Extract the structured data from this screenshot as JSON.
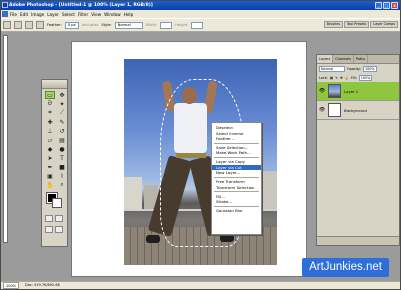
{
  "window": {
    "title": "Adobe Photoshop - [Untitled-1 @ 100% (Layer 1, RGB/8)]",
    "buttons": [
      "_",
      "□",
      "x"
    ]
  },
  "menubar": [
    "File",
    "Edit",
    "Image",
    "Layer",
    "Select",
    "Filter",
    "View",
    "Window",
    "Help"
  ],
  "options": {
    "feather_label": "Feather:",
    "feather_value": "0 px",
    "antialias_label": "Anti-alias",
    "style_label": "Style:",
    "style_value": "Normal",
    "width_label": "Width:",
    "height_label": "Height:"
  },
  "palette_well": [
    "Brushes",
    "Tool Presets",
    "Layer Comps"
  ],
  "context_menu": {
    "items": [
      "Deselect",
      "Select Inverse",
      "Feather...",
      "---",
      "Save Selection...",
      "Make Work Path...",
      "---",
      "Layer via Copy",
      "Layer via Cut",
      "New Layer...",
      "---",
      "Free Transform",
      "Transform Selection",
      "---",
      "Fill...",
      "Stroke...",
      "---",
      "Gaussian Blur"
    ],
    "highlighted": "Layer via Cut"
  },
  "layers_panel": {
    "tabs": [
      "Layers",
      "Channels",
      "Paths"
    ],
    "blend_mode": "Normal",
    "opacity_label": "Opacity:",
    "opacity_value": "100%",
    "lock_label": "Lock:",
    "fill_label": "Fill:",
    "fill_value": "100%",
    "layers": [
      {
        "name": "Layer 1",
        "active": true
      },
      {
        "name": "Background",
        "active": false
      }
    ]
  },
  "statusbar": {
    "zoom": "100%",
    "doc": "Doc: 519.7K/692.6K"
  },
  "watermark": "ArtJunkies.net",
  "colors": {
    "title_blue": "#0a3fa8",
    "highlight": "#316ac5",
    "active_layer": "#8ec63f",
    "watermark": "#2d6edb"
  }
}
